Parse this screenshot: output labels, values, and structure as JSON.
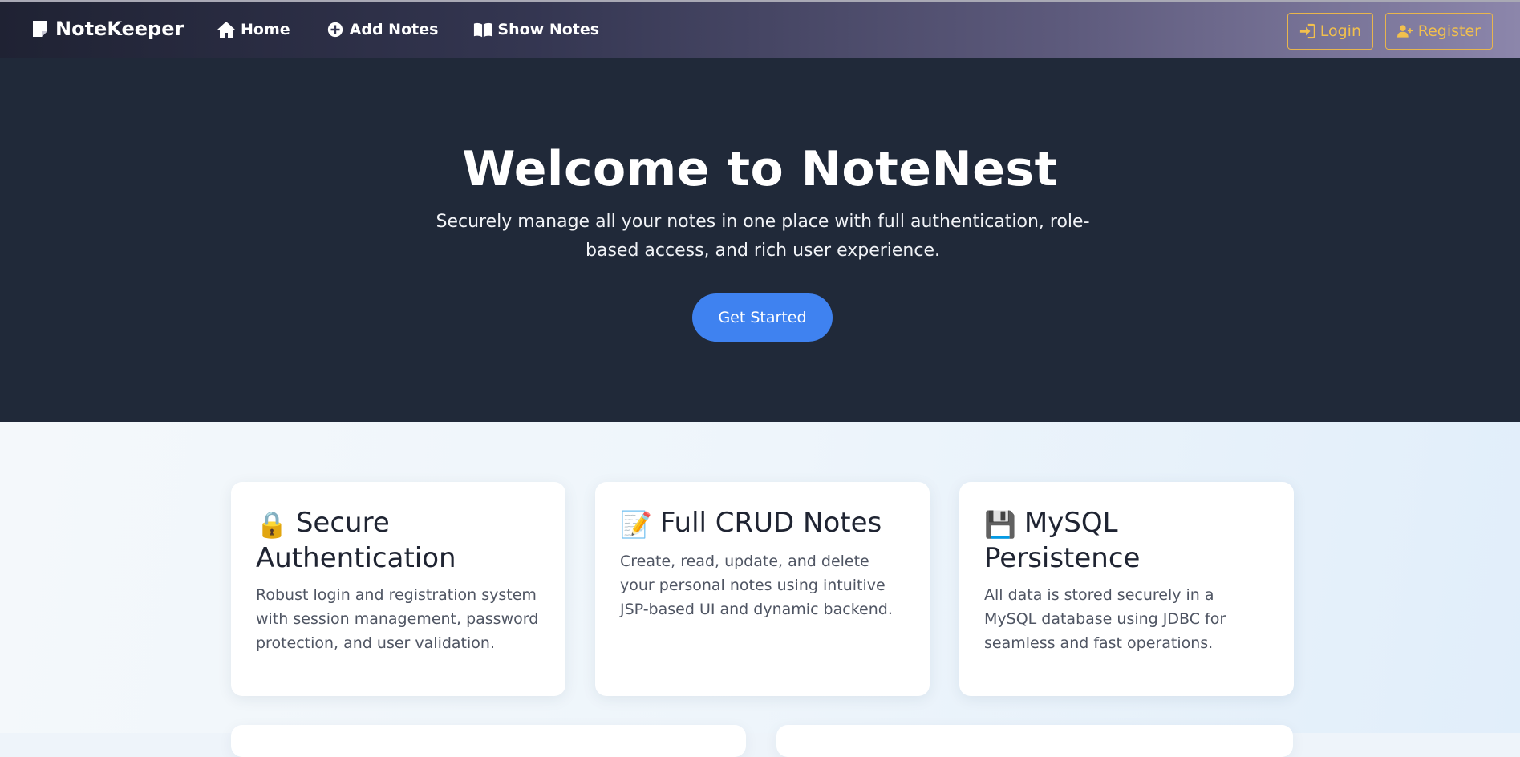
{
  "navbar": {
    "brand": "NoteKeeper",
    "links": [
      {
        "label": "Home",
        "icon": "home-icon"
      },
      {
        "label": "Add Notes",
        "icon": "plus-circle-icon"
      },
      {
        "label": "Show Notes",
        "icon": "book-icon"
      }
    ],
    "login_label": "Login",
    "register_label": "Register",
    "colors": {
      "auth_accent": "#f2c04d"
    }
  },
  "hero": {
    "title": "Welcome to NoteNest",
    "subtitle": "Securely manage all your notes in one place with full authentication, role-based access, and rich user experience.",
    "cta_label": "Get Started",
    "colors": {
      "background": "#202939",
      "cta": "#3f82f0"
    }
  },
  "features": [
    {
      "emoji": "🔒",
      "title": "Secure Authentication",
      "description": "Robust login and registration system with session management, password protection, and user validation."
    },
    {
      "emoji": "📝",
      "title": "Full CRUD Notes",
      "description": "Create, read, update, and delete your personal notes using intuitive JSP-based UI and dynamic backend."
    },
    {
      "emoji": "💾",
      "title": "MySQL Persistence",
      "description": "All data is stored securely in a MySQL database using JDBC for seamless and fast operations."
    }
  ]
}
